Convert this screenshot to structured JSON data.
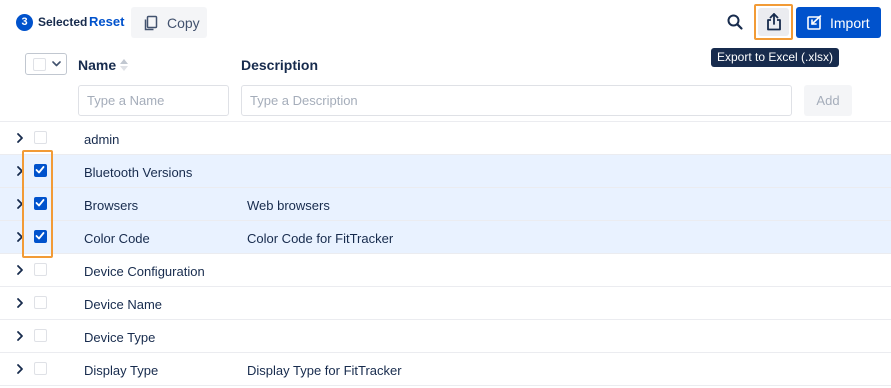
{
  "toolbar": {
    "selected_count": "3",
    "selected_label": "Selected",
    "reset_label": "Reset",
    "copy_label": "Copy",
    "import_label": "Import",
    "export_tooltip": "Export to Excel (.xlsx)"
  },
  "table": {
    "columns": {
      "name": "Name",
      "description": "Description"
    },
    "filters": {
      "name_placeholder": "Type a Name",
      "description_placeholder": "Type a Description",
      "add_label": "Add"
    },
    "rows": [
      {
        "name": "admin",
        "description": "",
        "checked": false
      },
      {
        "name": "Bluetooth Versions",
        "description": "",
        "checked": true
      },
      {
        "name": "Browsers",
        "description": "Web browsers",
        "checked": true
      },
      {
        "name": "Color Code",
        "description": "Color Code for FitTracker",
        "checked": true
      },
      {
        "name": "Device Configuration",
        "description": "",
        "checked": false
      },
      {
        "name": "Device Name",
        "description": "",
        "checked": false
      },
      {
        "name": "Device Type",
        "description": "",
        "checked": false
      },
      {
        "name": "Display Type",
        "description": "Display Type for FitTracker",
        "checked": false
      }
    ]
  },
  "colors": {
    "accent": "#0052cc",
    "highlight": "#f29b36",
    "selected_row": "#e9f2ff",
    "tooltip_bg": "#172b4d"
  },
  "icons": {
    "copy": "copy-icon",
    "search": "search-icon",
    "export": "share-export-icon",
    "import": "import-icon",
    "expand": "chevron-right-icon",
    "sort": "sort-icon",
    "dropdown": "chevron-down-icon"
  }
}
